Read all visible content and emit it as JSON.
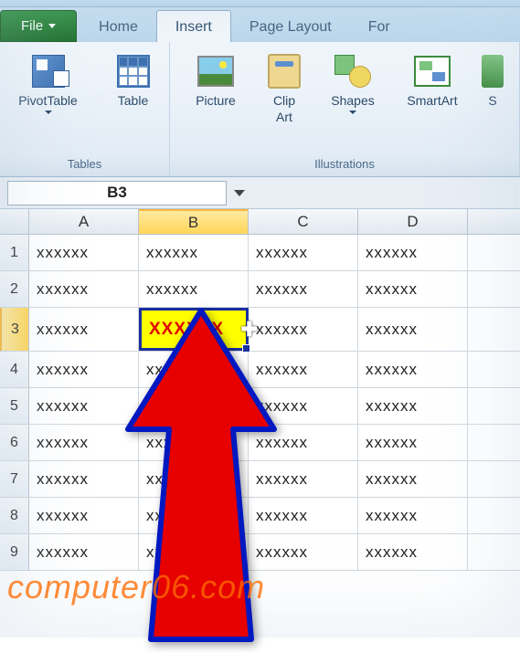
{
  "tabs": {
    "file": "File",
    "home": "Home",
    "insert": "Insert",
    "pagelayout": "Page Layout",
    "formulas_partial": "For"
  },
  "ribbon": {
    "tables": {
      "label": "Tables",
      "pivot": "PivotTable",
      "table": "Table"
    },
    "illustrations": {
      "label": "Illustrations",
      "picture": "Picture",
      "clipart_l1": "Clip",
      "clipart_l2": "Art",
      "shapes": "Shapes",
      "smartart": "SmartArt",
      "screenshot_partial": "S"
    }
  },
  "namebox": "B3",
  "columns": [
    "A",
    "B",
    "C",
    "D"
  ],
  "rows": [
    "1",
    "2",
    "3",
    "4",
    "5",
    "6",
    "7",
    "8",
    "9"
  ],
  "selected": {
    "row": "3",
    "col": "B"
  },
  "cells": {
    "r1": {
      "A": "xxxxxx",
      "B": "xxxxxx",
      "C": "xxxxxx",
      "D": "xxxxxx"
    },
    "r2": {
      "A": "xxxxxx",
      "B": "xxxxxx",
      "C": "xxxxxx",
      "D": "xxxxxx"
    },
    "r3": {
      "A": "xxxxxx",
      "B": "XXXXXX",
      "C": "xxxxxx",
      "D": "xxxxxx"
    },
    "r4": {
      "A": "xxxxxx",
      "B": "xxxxxx",
      "C": "xxxxxx",
      "D": "xxxxxx"
    },
    "r5": {
      "A": "xxxxxx",
      "B": "xxxxxx",
      "C": "xxxxxx",
      "D": "xxxxxx"
    },
    "r6": {
      "A": "xxxxxx",
      "B": "xxxxxx",
      "C": "xxxxxx",
      "D": "xxxxxx"
    },
    "r7": {
      "A": "xxxxxx",
      "B": "xxxxxx",
      "C": "xxxxxx",
      "D": "xxxxxx"
    },
    "r8": {
      "A": "xxxxxx",
      "B": "xxxxxx",
      "C": "xxxxxx",
      "D": "xxxxxx"
    },
    "r9": {
      "A": "xxxxxx",
      "B": "xxxxxx",
      "C": "xxxxxx",
      "D": "xxxxxx"
    }
  },
  "watermark": "computer06.com"
}
